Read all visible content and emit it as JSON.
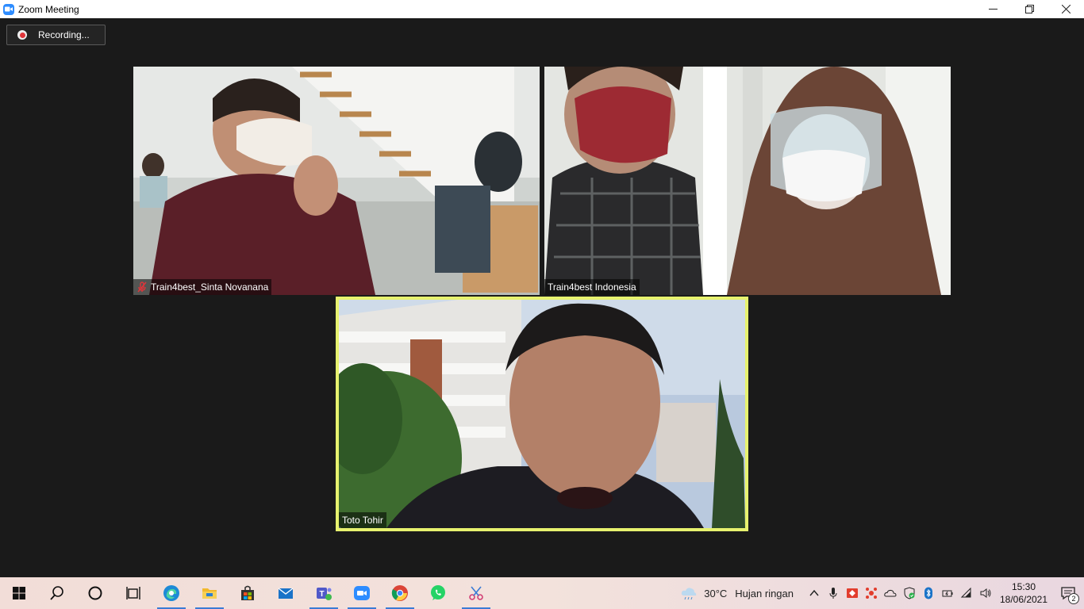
{
  "window": {
    "title": "Zoom Meeting",
    "controls": [
      "minimize-icon",
      "restore-icon",
      "close-icon"
    ]
  },
  "recording": {
    "label": "Recording..."
  },
  "participants": [
    {
      "name": "Train4best_Sinta Novanana",
      "muted": true
    },
    {
      "name": "Train4best Indonesia",
      "muted": false
    },
    {
      "name": "Toto Tohir",
      "muted": false,
      "active_speaker": true
    }
  ],
  "taskbar": {
    "apps": [
      "start-icon",
      "search-icon",
      "cortana-icon",
      "task-view-icon",
      "edge-icon",
      "file-explorer-icon",
      "store-icon",
      "mail-icon",
      "teams-icon",
      "zoom-icon",
      "chrome-icon",
      "whatsapp-icon",
      "snip-icon"
    ],
    "weather": {
      "temp": "30°C",
      "condition": "Hujan ringan"
    },
    "clock": {
      "time": "15:30",
      "date": "18/06/2021"
    },
    "notifications": "2"
  },
  "colors": {
    "active_speaker_border": "#e7f26f",
    "recording_dot": "#e0353a",
    "zoom_blue": "#2d8cff"
  }
}
